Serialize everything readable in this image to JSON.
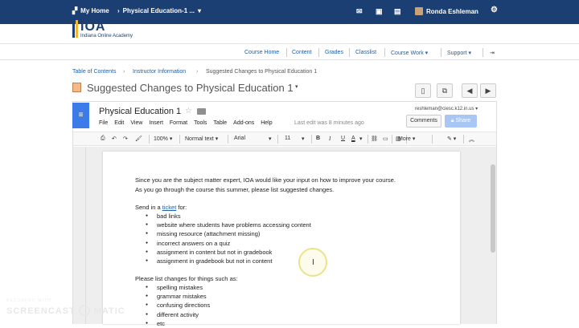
{
  "topbar": {
    "home": "My Home",
    "course": "Physical Education-1 ...",
    "user": "Ronda Eshleman"
  },
  "logo": {
    "name": "IOA",
    "subtitle": "Indiana Online Academy"
  },
  "nav": {
    "course_home": "Course Home",
    "content": "Content",
    "grades": "Grades",
    "classlist": "Classlist",
    "course_work": "Course Work",
    "support": "Support"
  },
  "breadcrumb": {
    "a": "Table of Contents",
    "b": "Instructor Information",
    "c": "Suggested Changes to Physical Education 1"
  },
  "page_title": "Suggested Changes to Physical Education 1",
  "doc": {
    "title": "Physical Education 1",
    "menu": [
      "File",
      "Edit",
      "View",
      "Insert",
      "Format",
      "Tools",
      "Table",
      "Add-ons",
      "Help"
    ],
    "last_edit": "Last edit was 8 minutes ago",
    "email": "reshleman@ciesc.k12.in.us",
    "comments": "Comments",
    "share": "Share",
    "toolbar": {
      "zoom": "100%",
      "style": "Normal text",
      "font": "Arial",
      "size": "11",
      "bold": "B",
      "italic": "I",
      "underline": "U",
      "text_color": "A",
      "more": "More"
    }
  },
  "content": {
    "intro1": "Since you are the subject matter expert, IOA would like your input on how to improve your course.",
    "intro2": "As you go through the course this summer, please list suggested changes.",
    "send_prefix": "Send in a ",
    "send_link": "ticket",
    "send_suffix": " for:",
    "list1": [
      "bad links",
      "website where students have problems accessing content",
      "missing resource (attachment missing)",
      "incorrect answers on a quiz",
      "assignment in content but not in gradebook",
      "assignment in gradebook but not in content"
    ],
    "list_heading": "Please list changes for things such as:",
    "list2": [
      "spelling mistakes",
      "grammar mistakes",
      "confusing directions",
      "different activity",
      "etc"
    ]
  },
  "watermark": {
    "line1": "RECORDED WITH",
    "line2": "SCREENCAST",
    "line3": "MATIC"
  },
  "colors": {
    "topbar": "#1c3f73",
    "link": "#1f5fa6",
    "docs_blue": "#3d7ce8",
    "share": "#a9c7f5"
  }
}
